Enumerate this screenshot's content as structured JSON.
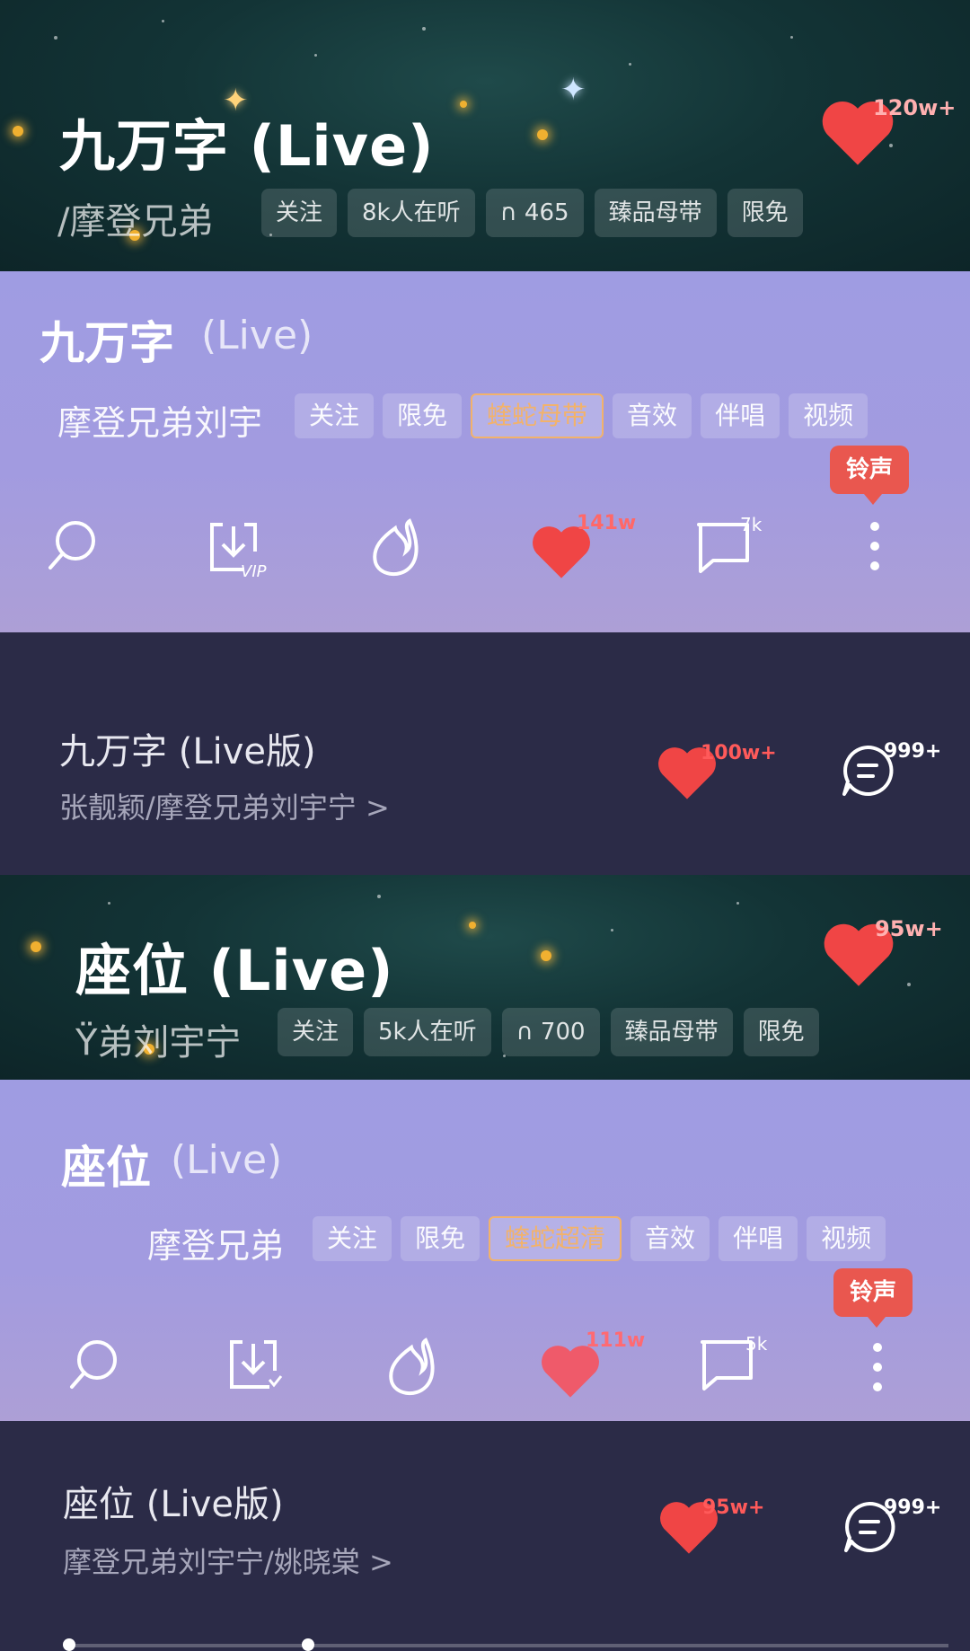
{
  "colors": {
    "accent_heart": "#f04545",
    "ringtone_badge": "#e9574f",
    "highlight_chip": "#f2b26b"
  },
  "card1": {
    "title": "九万字 (Live)",
    "artist": "/摩登兄弟",
    "chips": [
      "关注",
      "8k人在听",
      "465",
      "臻品母带",
      "限免"
    ],
    "likes": "120w+"
  },
  "card2": {
    "title": "九万字",
    "title_suffix": "(Live)",
    "artist": "摩登兄弟刘宇",
    "chips": [
      "关注",
      "限免",
      "蝰蛇母带",
      "音效",
      "伴唱",
      "视频"
    ],
    "ringtone": "铃声",
    "likes": "141w",
    "comments": "7k"
  },
  "card3": {
    "title": "九万字 (Live版)",
    "artists": "张靓颖/摩登兄弟刘宇宁 >",
    "likes": "100w+",
    "comments": "999+"
  },
  "card4": {
    "title": "座位 (Live)",
    "artist": "Ϋ弟刘宇宁",
    "chips": [
      "关注",
      "5k人在听",
      "700",
      "臻品母带",
      "限免"
    ],
    "likes": "95w+"
  },
  "card5": {
    "title": "座位",
    "title_suffix": "(Live)",
    "artist": "摩登兄弟",
    "chips": [
      "关注",
      "限免",
      "蝰蛇超清",
      "音效",
      "伴唱",
      "视频"
    ],
    "ringtone": "铃声",
    "likes": "111w",
    "comments": "5k"
  },
  "card6": {
    "title": "座位 (Live版)",
    "artists": "摩登兄弟刘宇宁/姚晓棠 >",
    "likes": "95w+",
    "comments": "999+"
  }
}
